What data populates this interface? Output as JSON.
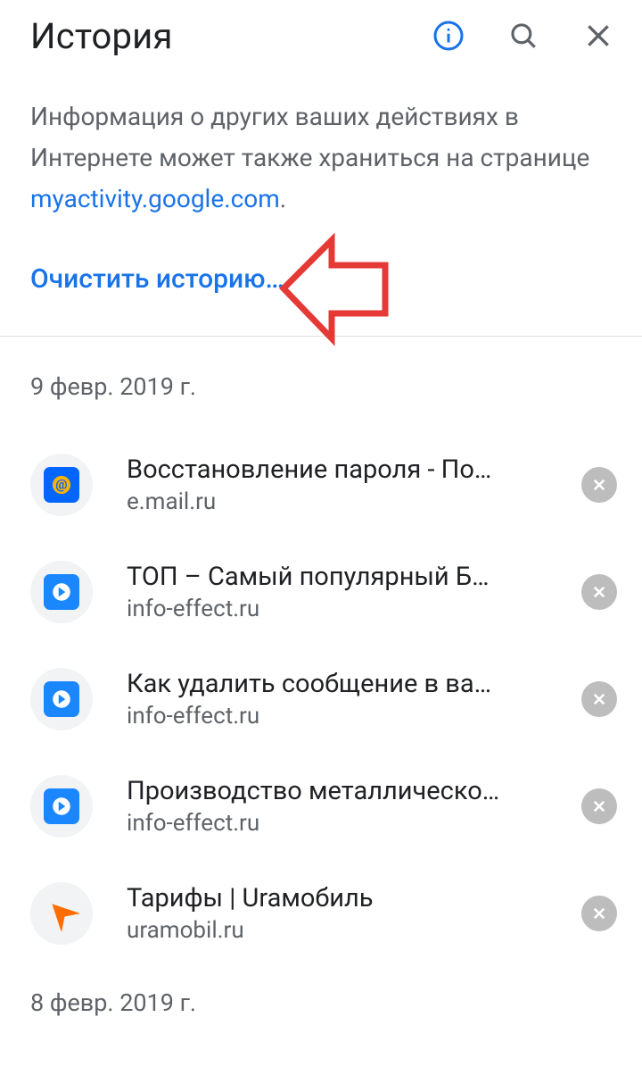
{
  "header": {
    "title": "История"
  },
  "info": {
    "text_prefix": "Информация о других ваших действиях в Интернете может также храниться на странице ",
    "link_text": "myactivity.google.com",
    "text_suffix": ".",
    "clear_label": "Очистить историю…"
  },
  "sections": [
    {
      "date": "9 февр. 2019 г.",
      "entries": [
        {
          "title": "Восстановление пароля - По…",
          "domain": "e.mail.ru",
          "favicon": "at"
        },
        {
          "title": "ТОП – Самый популярный Б…",
          "domain": "info-effect.ru",
          "favicon": "arrow-blue"
        },
        {
          "title": "Как удалить сообщение в ва…",
          "domain": "info-effect.ru",
          "favicon": "arrow-blue"
        },
        {
          "title": "Производство металлическо…",
          "domain": "info-effect.ru",
          "favicon": "arrow-blue"
        },
        {
          "title": "Тарифы | Uraмобиль",
          "domain": "uramobil.ru",
          "favicon": "arrow-orange"
        }
      ]
    },
    {
      "date": "8 февр. 2019 г.",
      "entries": []
    }
  ],
  "colors": {
    "link": "#1a73e8",
    "annotation": "#e53935"
  }
}
